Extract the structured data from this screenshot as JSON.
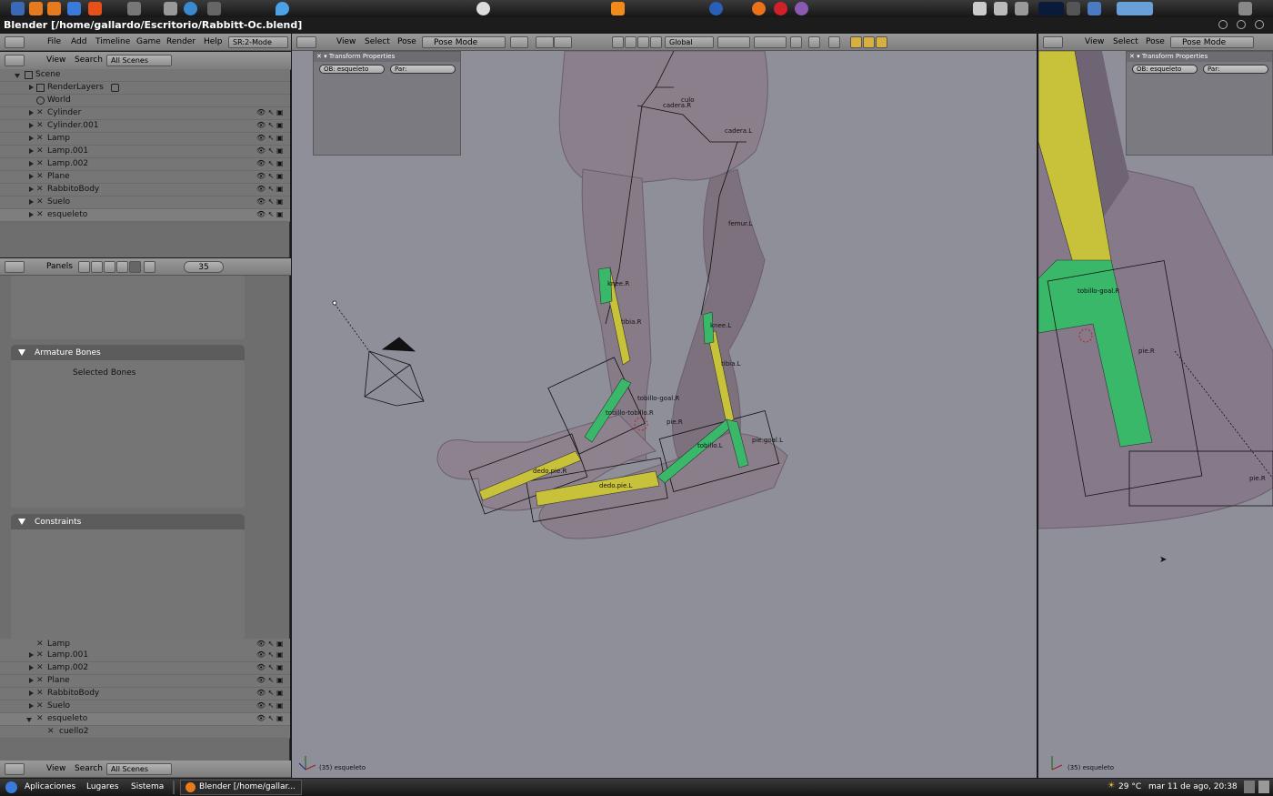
{
  "window": {
    "title": "Blender [/home/gallardo/Escritorio/Rabbitt-Oc.blend]"
  },
  "menu": {
    "items": [
      "File",
      "Add",
      "Timeline",
      "Game",
      "Render",
      "Help"
    ],
    "screen": "SR:2-Mode"
  },
  "outliner_header": {
    "view": "View",
    "search": "Search",
    "scope": "All Scenes"
  },
  "outliner_top": {
    "rows": [
      "Scene",
      "RenderLayers",
      "World",
      "Cylinder",
      "Cylinder.001",
      "Lamp",
      "Lamp.001",
      "Lamp.002",
      "Plane",
      "RabbitoBody",
      "Suelo",
      "esqueleto"
    ]
  },
  "outliner_bottom": {
    "rows": [
      "Lamp",
      "Lamp.001",
      "Lamp.002",
      "Plane",
      "RabbitoBody",
      "Suelo",
      "esqueleto",
      "cuello2"
    ]
  },
  "buttons_header": {
    "panels": "Panels",
    "frame": "35"
  },
  "panels": {
    "armature_bones": "Armature Bones",
    "selected_bones": "Selected Bones",
    "constraints": "Constraints"
  },
  "viewport_header": {
    "view": "View",
    "select": "Select",
    "pose": "Pose",
    "mode": "Pose Mode",
    "orientation": "Global"
  },
  "transform_panel": {
    "title": "Transform Properties",
    "ob_field": "OB: esqueleto",
    "par_field": "Par:"
  },
  "viewport_status": {
    "main": "(35) esqueleto",
    "right": "(35) esqueleto"
  },
  "bone_labels": {
    "culo": "culo",
    "cadera_r": "cadera.R",
    "cadera_l": "cadera.L",
    "femur_l": "femur.L",
    "knee_r": "knee.R",
    "knee_l": "knee.L",
    "tibia_r": "tibia.R",
    "tibia_l": "tibia.L",
    "tobillo_goal_r": "tobillo-goal.R",
    "tobillo_tobillo_r": "tobillo-tobillo.R",
    "pie_r": "pie.R",
    "pie_goal_l": "pie.goal.L",
    "dedo_pie_r": "dedo.pie.R",
    "dedo_pie_l": "dedo.pie.L",
    "tobillo_l": "tobillo.L"
  },
  "right_labels": {
    "tobillo_goal_r": "tobillo-goal.R",
    "pie_r": "pie.R",
    "pie_r2": "pie.R"
  },
  "taskbar": {
    "apps": "Aplicaciones",
    "places": "Lugares",
    "system": "Sistema",
    "task": "Blender [/home/gallar...",
    "temp": "29 °C",
    "clock": "mar 11 de ago, 20:38"
  },
  "colors": {
    "bone_yellow": "#c8c23a",
    "bone_green": "#3ab86a",
    "mesh": "#8b7f8c",
    "viewport_bg": "#8f8f99"
  }
}
